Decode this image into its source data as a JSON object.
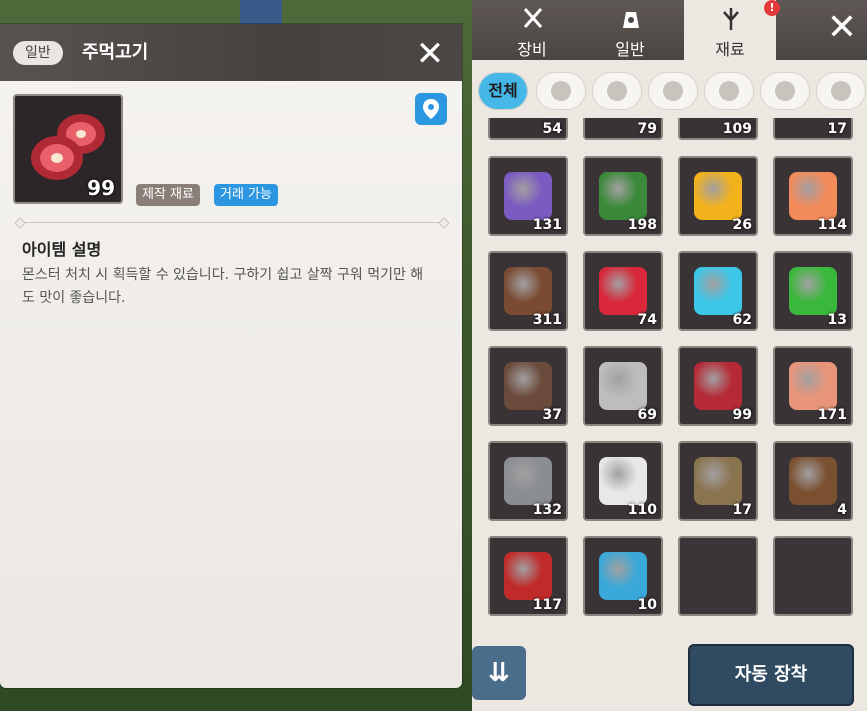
{
  "background": {
    "collapse_icon": "double-chevron-left-icon"
  },
  "detail": {
    "category_badge": "일반",
    "item_name": "주먹고기",
    "close_icon": "close-icon",
    "item_quantity": "99",
    "tags": [
      "제작 재료",
      "거래 가능"
    ],
    "location_icon": "location-pin-icon",
    "description_title": "아이템 설명",
    "description_text": "몬스터 처치 시 획득할 수 있습니다. 구하기 쉽고 살짝 구워 먹기만 해도 맛이 좋습니다."
  },
  "inventory": {
    "tabs": [
      {
        "label": "장비",
        "icon": "sword-icon",
        "active": false
      },
      {
        "label": "일반",
        "icon": "bag-icon",
        "active": false
      },
      {
        "label": "재료",
        "icon": "plant-icon",
        "active": true
      }
    ],
    "notification_mark": "!",
    "close_icon": "close-icon",
    "filters": [
      {
        "label": "전체",
        "icon": "",
        "active": true
      },
      {
        "label": "",
        "icon": "herb-icon",
        "active": false
      },
      {
        "label": "",
        "icon": "fruit-icon",
        "active": false
      },
      {
        "label": "",
        "icon": "ore-icon",
        "active": false
      },
      {
        "label": "",
        "icon": "meat-icon",
        "active": false
      },
      {
        "label": "",
        "icon": "fish-icon",
        "active": false
      },
      {
        "label": "",
        "icon": "pouch-icon",
        "active": false
      }
    ],
    "partial_row": [
      "54",
      "79",
      "109",
      "17"
    ],
    "rows": [
      [
        {
          "name": "lavender",
          "qty": "131",
          "color": "#7a5bc2"
        },
        {
          "name": "leaf",
          "qty": "198",
          "color": "#3b8a3a"
        },
        {
          "name": "mango",
          "qty": "26",
          "color": "#f2b21c"
        },
        {
          "name": "peach",
          "qty": "114",
          "color": "#f28a5a"
        }
      ],
      [
        {
          "name": "branch",
          "qty": "311",
          "color": "#7a4a32"
        },
        {
          "name": "red-crystal",
          "qty": "74",
          "color": "#d8283a"
        },
        {
          "name": "blue-crystal",
          "qty": "62",
          "color": "#3cc6e8"
        },
        {
          "name": "green-crystal",
          "qty": "13",
          "color": "#3ab83c"
        }
      ],
      [
        {
          "name": "rock",
          "qty": "37",
          "color": "#6a4a3a"
        },
        {
          "name": "silver-ore",
          "qty": "69",
          "color": "#bdbdbd"
        },
        {
          "name": "raw-meat",
          "qty": "99",
          "color": "#b52a36"
        },
        {
          "name": "drumstick",
          "qty": "171",
          "color": "#e8957a"
        }
      ],
      [
        {
          "name": "gray-stone",
          "qty": "132",
          "color": "#8a8d92"
        },
        {
          "name": "white-ingot",
          "qty": "110",
          "color": "#e8e8e8"
        },
        {
          "name": "rope",
          "qty": "17",
          "color": "#8a7450"
        },
        {
          "name": "leather-bundle",
          "qty": "4",
          "color": "#7a5030"
        }
      ],
      [
        {
          "name": "ruby",
          "qty": "117",
          "color": "#c02a2a"
        },
        {
          "name": "aqua-gem",
          "qty": "10",
          "color": "#3aa8d8"
        },
        {
          "name": "empty",
          "qty": "",
          "color": ""
        },
        {
          "name": "empty",
          "qty": "",
          "color": ""
        }
      ]
    ],
    "sort_button_icon": "sort-icon",
    "auto_equip_label": "자동 장착"
  }
}
